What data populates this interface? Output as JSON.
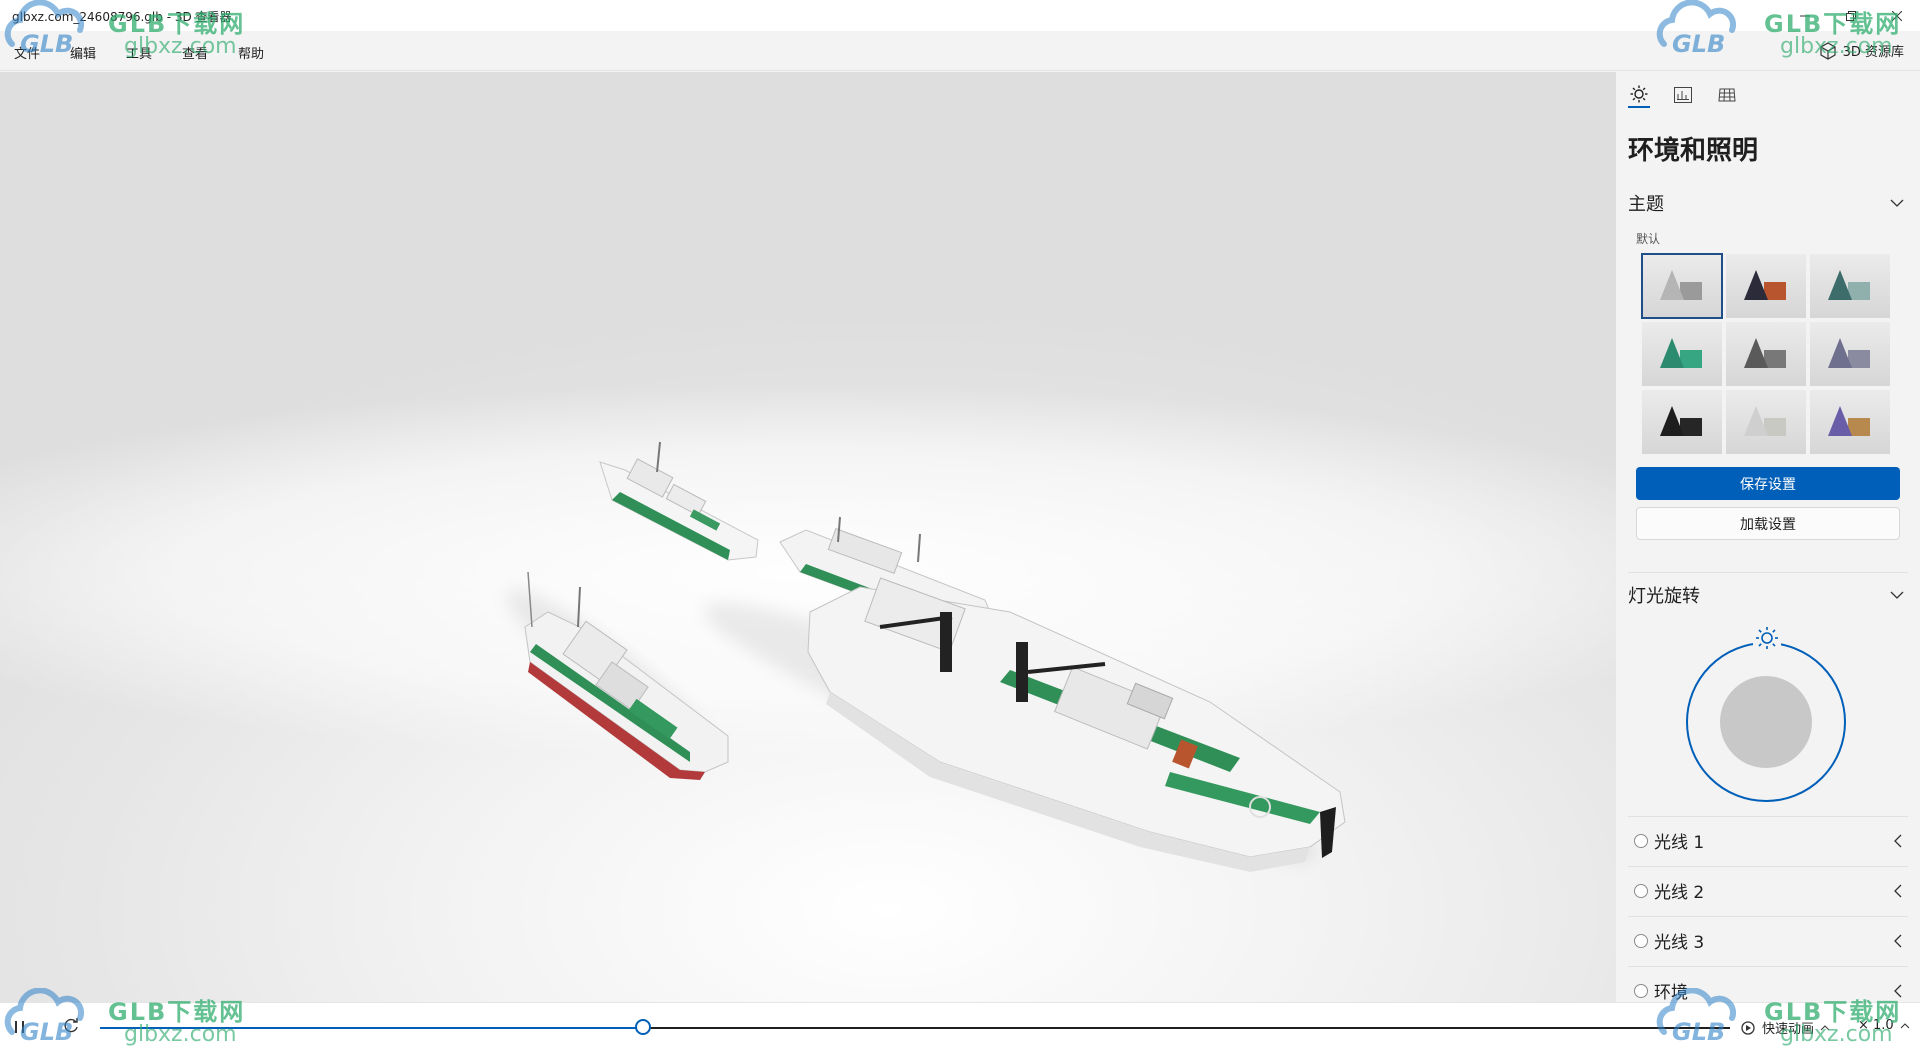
{
  "window": {
    "title": "glbxz.com_24608796.glb - 3D 查看器",
    "min_icon": "minimize-icon",
    "max_icon": "restore-icon",
    "close_icon": "close-icon"
  },
  "menu": {
    "items": [
      "文件",
      "编辑",
      "工具",
      "查看",
      "帮助"
    ],
    "library_label": "3D 资源库",
    "library_icon": "cube-icon"
  },
  "panel": {
    "tabs": [
      {
        "icon": "sun-icon",
        "active": true
      },
      {
        "icon": "stats-icon",
        "active": false
      },
      {
        "icon": "grid-icon",
        "active": false
      }
    ],
    "heading": "环境和照明",
    "theme": {
      "section_label": "主题",
      "default_label": "默认",
      "tiles": [
        {
          "cone": "#b5b5b5",
          "cube": "#9a9a9a",
          "selected": true
        },
        {
          "cone": "#2b2b3a",
          "cube": "#b8552e",
          "selected": false
        },
        {
          "cone": "#3d6d6b",
          "cube": "#8fb0ad",
          "selected": false
        },
        {
          "cone": "#2c8a6e",
          "cube": "#36a582",
          "selected": false
        },
        {
          "cone": "#5a5a5a",
          "cube": "#787878",
          "selected": false
        },
        {
          "cone": "#6f6f8e",
          "cube": "#8a8aa0",
          "selected": false
        },
        {
          "cone": "#1e1e1e",
          "cube": "#262626",
          "selected": false
        },
        {
          "cone": "#cfcfcf",
          "cube": "#c9c9c4",
          "selected": false
        },
        {
          "cone": "#6a5da8",
          "cube": "#b8894e",
          "selected": false
        }
      ],
      "save_label": "保存设置",
      "load_label": "加载设置"
    },
    "light_rotation": {
      "section_label": "灯光旋转"
    },
    "lights": [
      {
        "label": "光线 1"
      },
      {
        "label": "光线 2"
      },
      {
        "label": "光线 3"
      },
      {
        "label": "环境"
      }
    ]
  },
  "playback": {
    "play_icon": "pause-icon",
    "loop_icon": "loop-icon",
    "progress": 0.333,
    "quick_anim_label": "快速动画",
    "speed_label": "× 1.0"
  },
  "watermark": {
    "brand": "GLB下载网",
    "logo_text": "GLB",
    "domain": "glbxz.com"
  },
  "colors": {
    "accent": "#005fb8",
    "hull_green": "#2f8f57"
  }
}
